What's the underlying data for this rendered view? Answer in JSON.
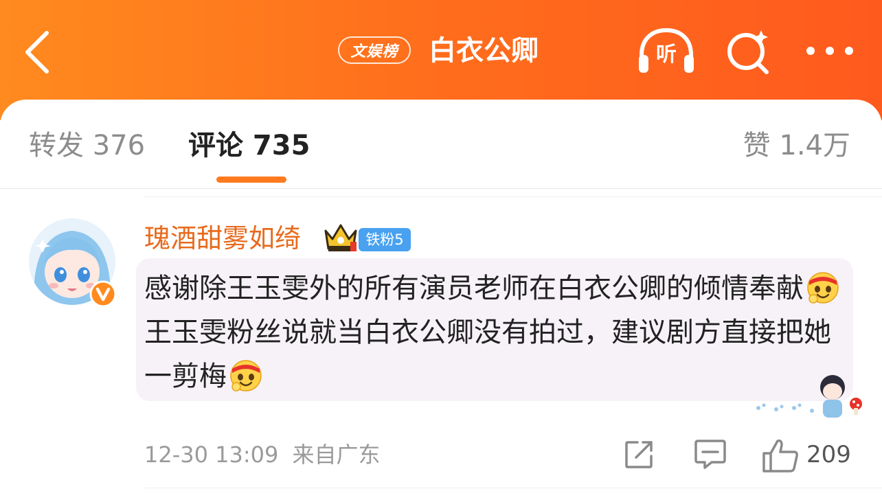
{
  "header": {
    "back_icon": "chevron-left-icon",
    "topic_badge": "文娱榜",
    "title": "白衣公卿",
    "listen_label": "听",
    "search_icon": "search-sparkle-icon",
    "more_icon": "more-dots-icon",
    "colors": {
      "gradient_start": "#ff8a1f",
      "gradient_end": "#ff5a1e"
    }
  },
  "tabs": {
    "repost": "转发 376",
    "comment": "评论 735",
    "like": "赞 1.4万",
    "active": "comment",
    "accent": "#ff7a1e"
  },
  "comment": {
    "username": "瑰酒甜雾如绮",
    "username_color": "#e86a1c",
    "crown_icon": "gold-crown-icon",
    "fan_badge": "铁粉5",
    "verified_icon": "orange-v-verified-icon",
    "text_parts": {
      "p1": "感谢除王玉雯外的所有演员老师在白衣公卿的倾情奉献",
      "p2": "王玉雯粉丝说就当白衣公卿没有拍过，建议剧方直接把她一剪梅"
    },
    "emoji": "headband-cheer-emoji",
    "time": "12-30 13:09",
    "location": "来自广东",
    "like_count": "209"
  },
  "actions": {
    "share_icon": "share-square-arrow-icon",
    "reply_icon": "comment-bubble-icon",
    "like_icon": "thumbs-up-icon"
  }
}
